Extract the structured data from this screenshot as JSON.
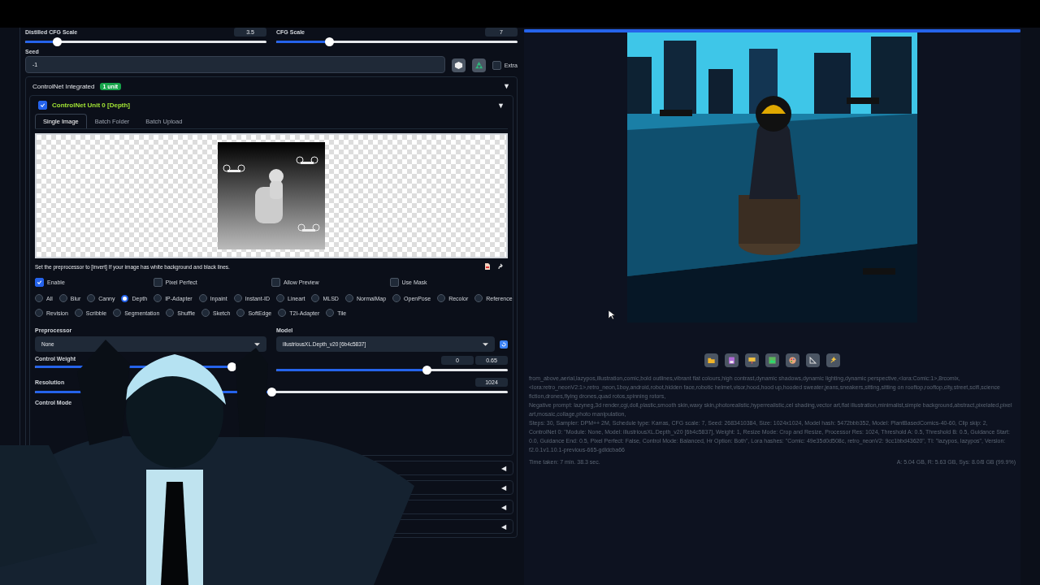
{
  "top_sliders": [
    {
      "label": "Distilled CFG Scale",
      "value": "3.5",
      "level": 0.13
    },
    {
      "label": "CFG Scale",
      "value": "7",
      "level": 0.22
    }
  ],
  "seed": {
    "label": "Seed",
    "value": "-1",
    "extra_label": "Extra",
    "extra_checked": false
  },
  "controlnet": {
    "title": "ControlNet Integrated",
    "badge": "1 unit",
    "expand_icon": "▼",
    "unit": {
      "enabled": true,
      "title": "ControlNet Unit 0 [Depth]",
      "expand_icon": "▼",
      "tabs": [
        {
          "label": "Single Image",
          "selected": true
        },
        {
          "label": "Batch Folder",
          "selected": false
        },
        {
          "label": "Batch Upload",
          "selected": false
        }
      ],
      "hint": "Set the preprocessor to [invert] If your image has white background and black lines.",
      "options": [
        {
          "label": "Enable",
          "checked": true
        },
        {
          "label": "Pixel Perfect",
          "checked": false
        },
        {
          "label": "Allow Preview",
          "checked": false
        },
        {
          "label": "Use Mask",
          "checked": false
        }
      ],
      "types": [
        {
          "label": "All",
          "selected": false
        },
        {
          "label": "Blur",
          "selected": false
        },
        {
          "label": "Canny",
          "selected": false
        },
        {
          "label": "Depth",
          "selected": true
        },
        {
          "label": "IP-Adapter",
          "selected": false
        },
        {
          "label": "Inpaint",
          "selected": false
        },
        {
          "label": "Instant-ID",
          "selected": false
        },
        {
          "label": "Lineart",
          "selected": false
        },
        {
          "label": "MLSD",
          "selected": false
        },
        {
          "label": "NormalMap",
          "selected": false
        },
        {
          "label": "OpenPose",
          "selected": false
        },
        {
          "label": "Recolor",
          "selected": false
        },
        {
          "label": "Reference",
          "selected": false
        },
        {
          "label": "Revision",
          "selected": false
        },
        {
          "label": "Scribble",
          "selected": false
        },
        {
          "label": "Segmentation",
          "selected": false
        },
        {
          "label": "Shuffle",
          "selected": false
        },
        {
          "label": "Sketch",
          "selected": false
        },
        {
          "label": "SoftEdge",
          "selected": false
        },
        {
          "label": "T2I-Adapter",
          "selected": false
        },
        {
          "label": "Tile",
          "selected": false
        }
      ],
      "preprocessor": {
        "label": "Preprocessor",
        "value": "None"
      },
      "model": {
        "label": "Model",
        "value": "illustriousXL.Depth_v20 [6b4c5837]"
      },
      "control_weight": {
        "label": "Control Weight",
        "level": 0.85
      },
      "timestep": {
        "start": "0",
        "end": "0.65",
        "level": 0.65
      },
      "resolution": {
        "label": "Resolution",
        "value": "1024",
        "level": 0.5
      },
      "control_mode": {
        "label": "Control Mode"
      }
    },
    "collapsed_panels": [
      {
        "icon": "◀"
      },
      {
        "icon": "◀"
      },
      {
        "icon": "◀"
      },
      {
        "icon": "◀"
      }
    ]
  },
  "output": {
    "progress": {
      "level": 1
    },
    "info_lines": [
      "from_above,aerial,lazypos,illustration,comic,bold outlines,vibrant flat colours,high contrast,dynamic shadows,dynamic lighting,dynamic perspective,<lora:Comic:1>,8rcomix, <lora:retro_neonV2:1>,retro_neon,1boy,android,robot,hidden face,robotic helmet,visor,hood,hood up,hooded sweater,jeans,sneakers,sitting,sitting on rooftop,rooftop,city,street,scifi,science fiction,drones,flying drones,quad rotos,spinning rotors,",
      "Negative prompt: lazyneg,3d render,cgi,doll,plastic,smooth skin,waxy skin,photorealistic,hyperrealistic,cel shading,vector art,flat illustration,minimalist,simple background,abstract,pixelated,pixel art,mosaic,collage,photo manipulation,",
      "Steps: 30, Sampler: DPM++ 2M, Schedule type: Karras, CFG scale: 7, Seed: 2683410384, Size: 1024x1024, Model hash: 5472bbb352, Model: PlantBasedComics-40-60, Clip skip: 2, ControlNet 0: \"Module: None, Model: illustriousXL.Depth_v20 [6b4c5837], Weight: 1, Resize Mode: Crop and Resize, Processor Res: 1024, Threshold A: 0.5, Threshold B: 0.5, Guidance Start: 0.0, Guidance End: 0.5, Pixel Perfect: False, Control Mode: Balanced, Hr Option: Both\", Lora hashes: \"Comic: 49e35d0d508c, retro_neonV2: 9cc1bbd43620\", TI: \"lazypos, lazypos\", Version: f2.0.1v1.10.1-previous-665-gdldcba66"
    ],
    "time_taken": "Time taken: 7 min. 38.3 sec.",
    "memory": "A: 5.04 GB, R: 5.63 GB, Sys: 8.0/8 GB (99.9%)"
  }
}
